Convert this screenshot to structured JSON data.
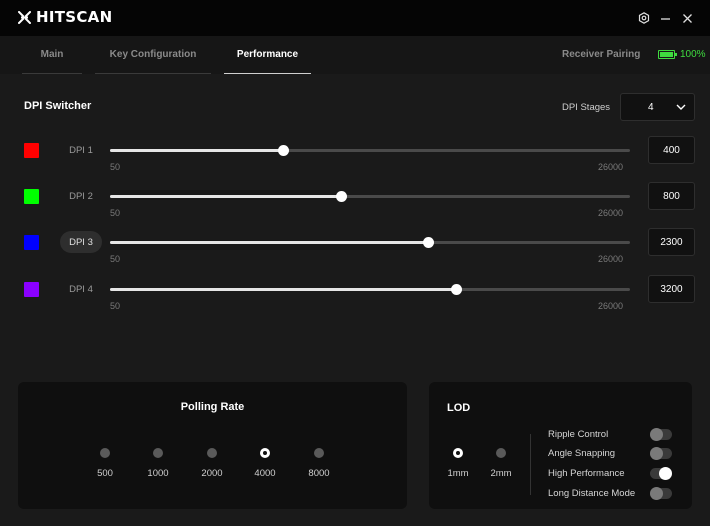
{
  "app": {
    "title": "HITSCAN",
    "logo_icon": "x-logo-icon"
  },
  "window_controls": [
    {
      "name": "settings-icon"
    },
    {
      "name": "minimize-icon"
    },
    {
      "name": "close-icon"
    }
  ],
  "tabs": [
    {
      "label": "Main",
      "active": false
    },
    {
      "label": "Key Configuration",
      "active": false
    },
    {
      "label": "Performance",
      "active": true
    }
  ],
  "receiver": {
    "label": "Receiver Pairing"
  },
  "battery": {
    "level_percent": 100,
    "text": "100%",
    "color": "#3fdc3f"
  },
  "dpi_switcher": {
    "title": "DPI Switcher",
    "stages_label": "DPI Stages",
    "stages_value": "4",
    "range_min": 50,
    "range_max": 26000,
    "min_label": "50",
    "max_label": "26000",
    "stages": [
      {
        "label": "DPI 1",
        "color": "#ff0000",
        "value": 400,
        "value_text": "400",
        "selected": false
      },
      {
        "label": "DPI 2",
        "color": "#00ff00",
        "value": 800,
        "value_text": "800",
        "selected": false
      },
      {
        "label": "DPI 3",
        "color": "#0000ff",
        "value": 2300,
        "value_text": "2300",
        "selected": true
      },
      {
        "label": "DPI 4",
        "color": "#8a00ff",
        "value": 3200,
        "value_text": "3200",
        "selected": false
      }
    ]
  },
  "polling_rate": {
    "title": "Polling Rate",
    "options": [
      "500",
      "1000",
      "2000",
      "4000",
      "8000"
    ],
    "selected": "4000"
  },
  "lod": {
    "title": "LOD",
    "options": [
      "1mm",
      "2mm"
    ],
    "selected": "1mm",
    "toggles": [
      {
        "label": "Ripple Control",
        "on": false
      },
      {
        "label": "Angle Snapping",
        "on": false
      },
      {
        "label": "High Performance",
        "on": true
      },
      {
        "label": "Long Distance Mode",
        "on": false
      }
    ]
  }
}
